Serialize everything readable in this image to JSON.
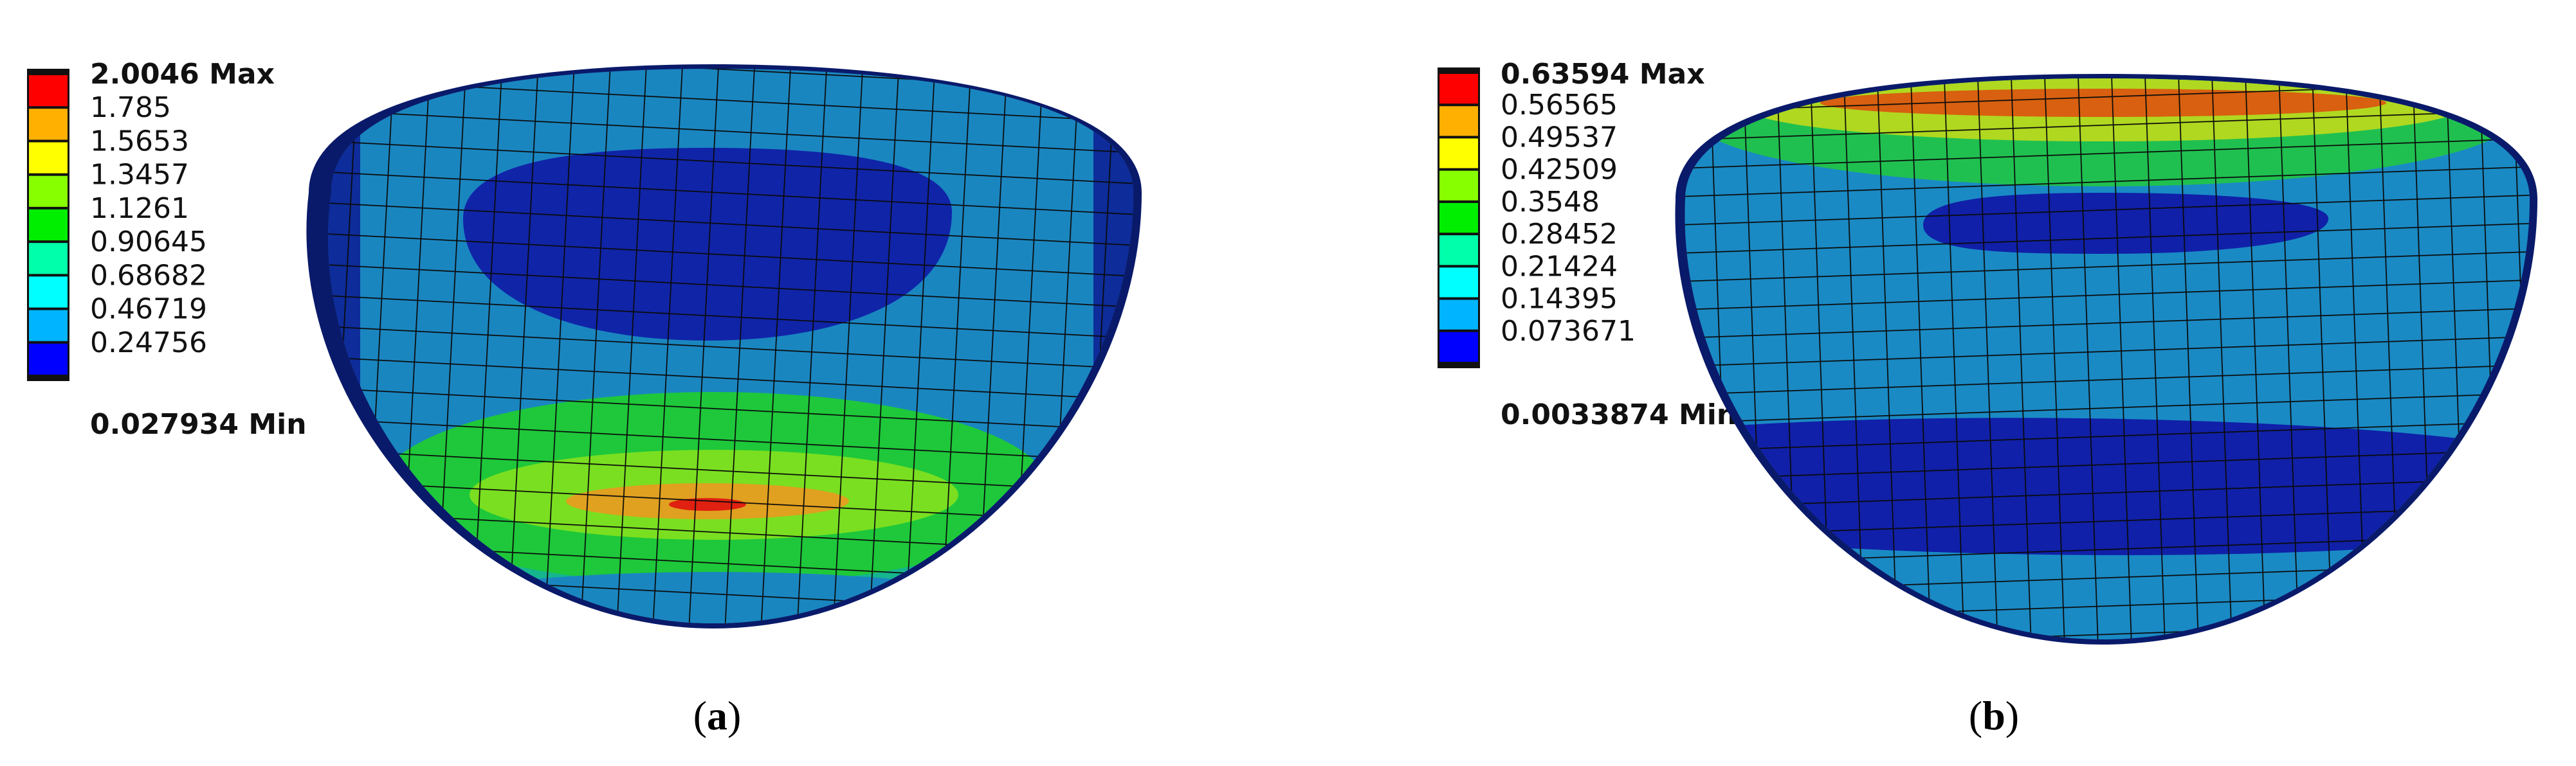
{
  "panels": [
    {
      "caption_open": "(",
      "caption_letter": "a",
      "caption_close": ")",
      "legend": {
        "max_label": "2.0046 Max",
        "min_label": "0.027934 Min",
        "levels": [
          "1.785",
          "1.5653",
          "1.3457",
          "1.1261",
          "0.90645",
          "0.68682",
          "0.46719",
          "0.24756"
        ]
      }
    },
    {
      "caption_open": "(",
      "caption_letter": "b",
      "caption_close": ")",
      "legend": {
        "max_label": "0.63594 Max",
        "min_label": "0.0033874 Min",
        "levels": [
          "0.56565",
          "0.49537",
          "0.42509",
          "0.3548",
          "0.28452",
          "0.21424",
          "0.14395",
          "0.073671"
        ]
      }
    }
  ],
  "colors": {
    "bands": [
      "#ff0000",
      "#ffb000",
      "#ffff00",
      "#88ff00",
      "#00ee00",
      "#00ffaa",
      "#00ffff",
      "#00b4ff",
      "#0000ff"
    ]
  }
}
